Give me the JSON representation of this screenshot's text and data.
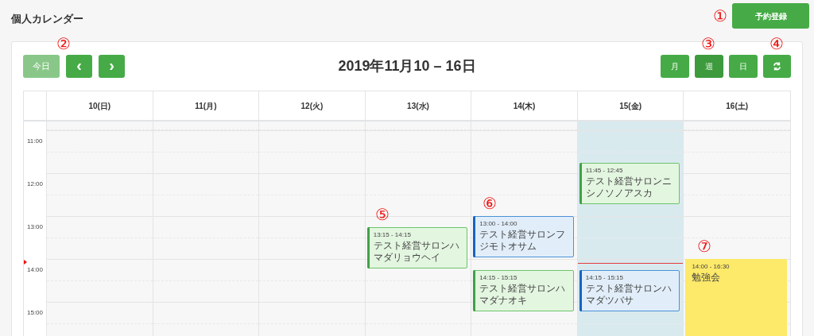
{
  "page_title": "個人カレンダー",
  "register_button": {
    "label": "予約登録",
    "callout": "①"
  },
  "toolbar": {
    "today_button": {
      "label": "今日",
      "disabled": true,
      "callout": "②"
    },
    "prev_button": {
      "label": "‹"
    },
    "next_button": {
      "label": "›"
    },
    "date_range": "2019年11月10 – 16日",
    "view_buttons": [
      {
        "label": "月",
        "selected": false
      },
      {
        "label": "週",
        "selected": true,
        "callout": "③"
      },
      {
        "label": "日",
        "selected": false
      }
    ],
    "refresh_button": {
      "callout": "④"
    }
  },
  "hours": [
    "11:00",
    "12:00",
    "13:00",
    "14:00",
    "15:00"
  ],
  "now_indicator": true,
  "days": [
    {
      "label": "10(日)",
      "selected": false
    },
    {
      "label": "11(月)",
      "selected": false
    },
    {
      "label": "12(火)",
      "selected": false
    },
    {
      "label": "13(水)",
      "selected": false,
      "events": [
        {
          "time": "13:15 - 14:15",
          "title": "テスト経営サロンハマダリョウヘイ",
          "color": "#43a047",
          "callout": "⑤"
        }
      ]
    },
    {
      "label": "14(木)",
      "selected": false,
      "events": [
        {
          "time": "13:00 - 14:00",
          "title": "テスト経営サロンフジモトオサム",
          "color": "#1565c0",
          "callout": "⑥"
        },
        {
          "time": "14:15 - 15:15",
          "title": "テスト経営サロンハマダナオキ",
          "color": "#43a047"
        }
      ]
    },
    {
      "label": "15(金)",
      "selected": true,
      "events": [
        {
          "time": "11:45 - 12:45",
          "title": "テスト経営サロンニシノソノアスカ",
          "color": "#43a047"
        },
        {
          "time": "14:15 - 15:15",
          "title": "テスト経営サロンハマダツバサ",
          "color": "#1565c0"
        }
      ]
    },
    {
      "label": "16(土)",
      "selected": false,
      "events": [
        {
          "time": "14:00 - 16:30",
          "title": "勉強会",
          "color": "#fde96a",
          "callout": "⑦"
        }
      ]
    }
  ]
}
